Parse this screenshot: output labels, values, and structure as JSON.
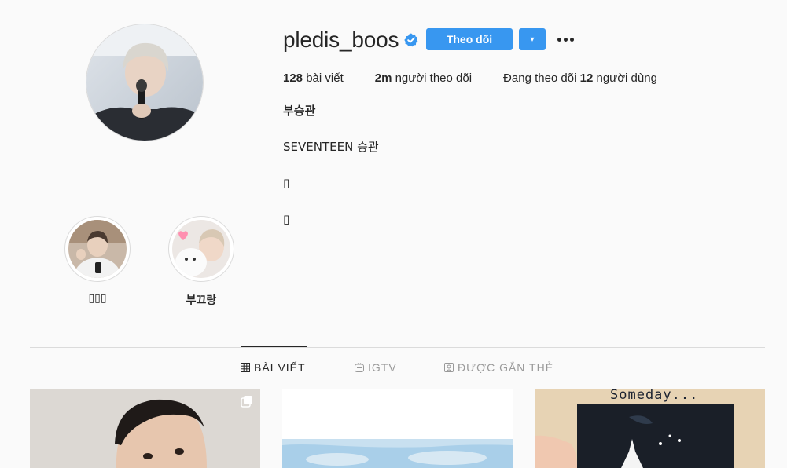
{
  "profile": {
    "username": "pledis_boos",
    "follow_label": "Theo dõi",
    "dropdown_glyph": "▾",
    "posts_count": "128",
    "posts_label": "bài viết",
    "followers_count": "2m",
    "followers_label": "người theo dõi",
    "following_prefix": "Đang theo dõi",
    "following_count": "12",
    "following_label": "người dùng",
    "full_name": "부승관",
    "bio_line1": "SEVENTEEN 승관",
    "bio_line2": "▯",
    "bio_line3": "▯"
  },
  "highlights": [
    {
      "label": "▯▯▯"
    },
    {
      "label": "부끄랑"
    }
  ],
  "tabs": [
    {
      "label": "BÀI VIẾT",
      "icon": "grid-icon",
      "active": true
    },
    {
      "label": "IGTV",
      "icon": "igtv-icon",
      "active": false
    },
    {
      "label": "ĐƯỢC GẮN THẺ",
      "icon": "tagged-icon",
      "active": false
    }
  ],
  "posts": [
    {
      "icon": "multi-post-icon"
    },
    {
      "icon": ""
    },
    {
      "caption": "Someday..."
    }
  ],
  "colors": {
    "accent": "#3897f0",
    "background": "#fafafa",
    "text": "#262626",
    "muted": "#999999",
    "border": "#dbdbdb"
  }
}
